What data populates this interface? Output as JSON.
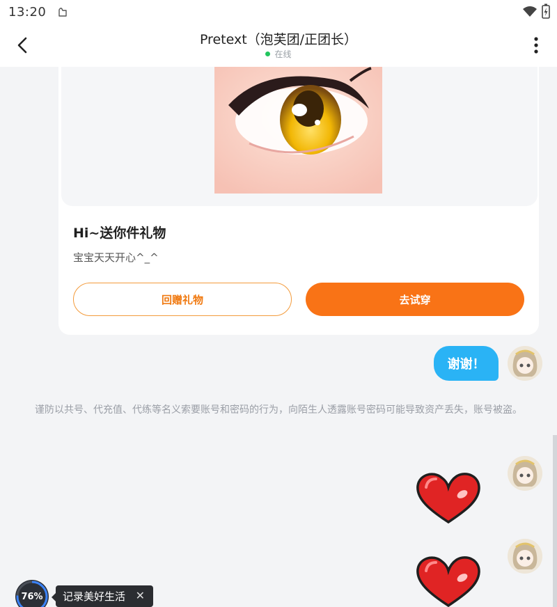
{
  "status_bar": {
    "time": "13:20",
    "app_icon": "android-notification-icon",
    "wifi_icon": "wifi-icon",
    "battery_icon": "battery-charging-icon"
  },
  "header": {
    "title": "Pretext（泡芙团/正团长）",
    "status": "在线",
    "back_icon": "chevron-left-icon",
    "more_icon": "more-vertical-icon"
  },
  "gift_card": {
    "image": "anime-eye-gift-image",
    "title": "Hi~送你件礼物",
    "message": "宝宝天天开心^_^",
    "return_button": "回赠礼物",
    "try_button": "去试穿"
  },
  "messages": {
    "thanks_text": "谢谢！",
    "safety_notice": "谨防以共号、代充值、代练等名义索要账号和密码的行为，向陌生人透露账号密码可能导致资产丢失，账号被盗。",
    "heart_sticker": "red-heart-sticker"
  },
  "floating_widget": {
    "progress": "76%",
    "progress_value": 0.76,
    "tip_text": "记录美好生活",
    "close_icon": "close-icon"
  },
  "colors": {
    "accent_orange": "#f97316",
    "bubble_blue": "#2ab3f5",
    "online_green": "#22c55e"
  }
}
